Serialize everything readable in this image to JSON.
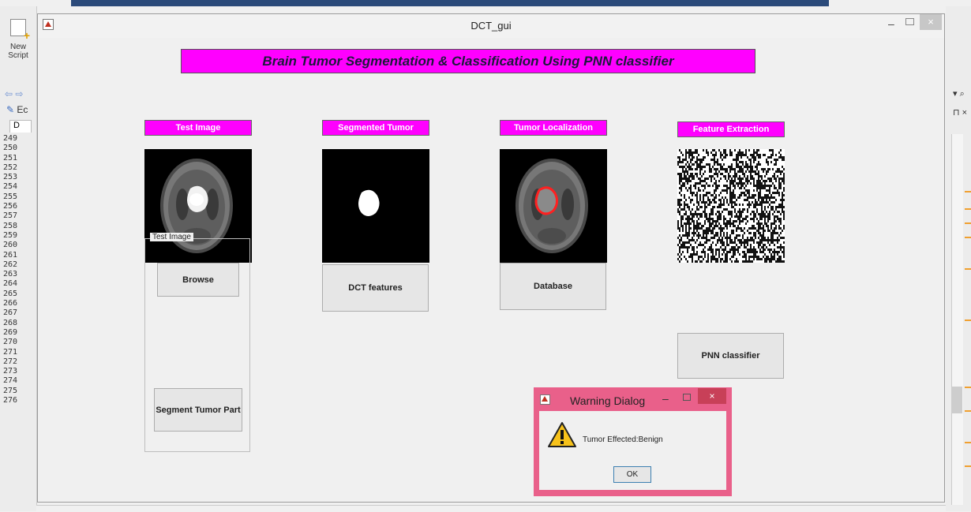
{
  "background": {
    "new_script_label_1": "New",
    "new_script_label_2": "Script",
    "editor_tab_short": "Ec",
    "doc_tab_short": "D",
    "line_numbers": [
      "249",
      "250",
      "251",
      "252",
      "253",
      "254",
      "255",
      "256",
      "257",
      "258",
      "259",
      "260",
      "261",
      "262",
      "263",
      "264",
      "265",
      "266",
      "267",
      "268",
      "269",
      "270",
      "271",
      "272",
      "273",
      "274",
      "275",
      "276"
    ]
  },
  "window": {
    "title": "DCT_gui",
    "min_label": "–",
    "close_label": "×"
  },
  "banner": {
    "text": "Brain Tumor Segmentation & Classification Using PNN classifier"
  },
  "panels": [
    {
      "label": "Test Image"
    },
    {
      "label": "Segmented Tumor"
    },
    {
      "label": "Tumor Localization"
    },
    {
      "label": "Feature Extraction"
    }
  ],
  "test_image_group": {
    "title": "Test Image",
    "browse_label": "Browse",
    "segment_label": "Segment Tumor Part"
  },
  "buttons": {
    "dct_label": "DCT features",
    "database_label": "Database",
    "pnn_label": "PNN classifier"
  },
  "dialog": {
    "title": "Warning Dialog",
    "message": "Tumor Effected:Benign",
    "ok_label": "OK",
    "min_label": "–",
    "close_label": "×"
  },
  "colors": {
    "banner_bg": "#ff00ff",
    "dialog_frame": "#e9608a",
    "tumor_outline": "#ff2020"
  }
}
